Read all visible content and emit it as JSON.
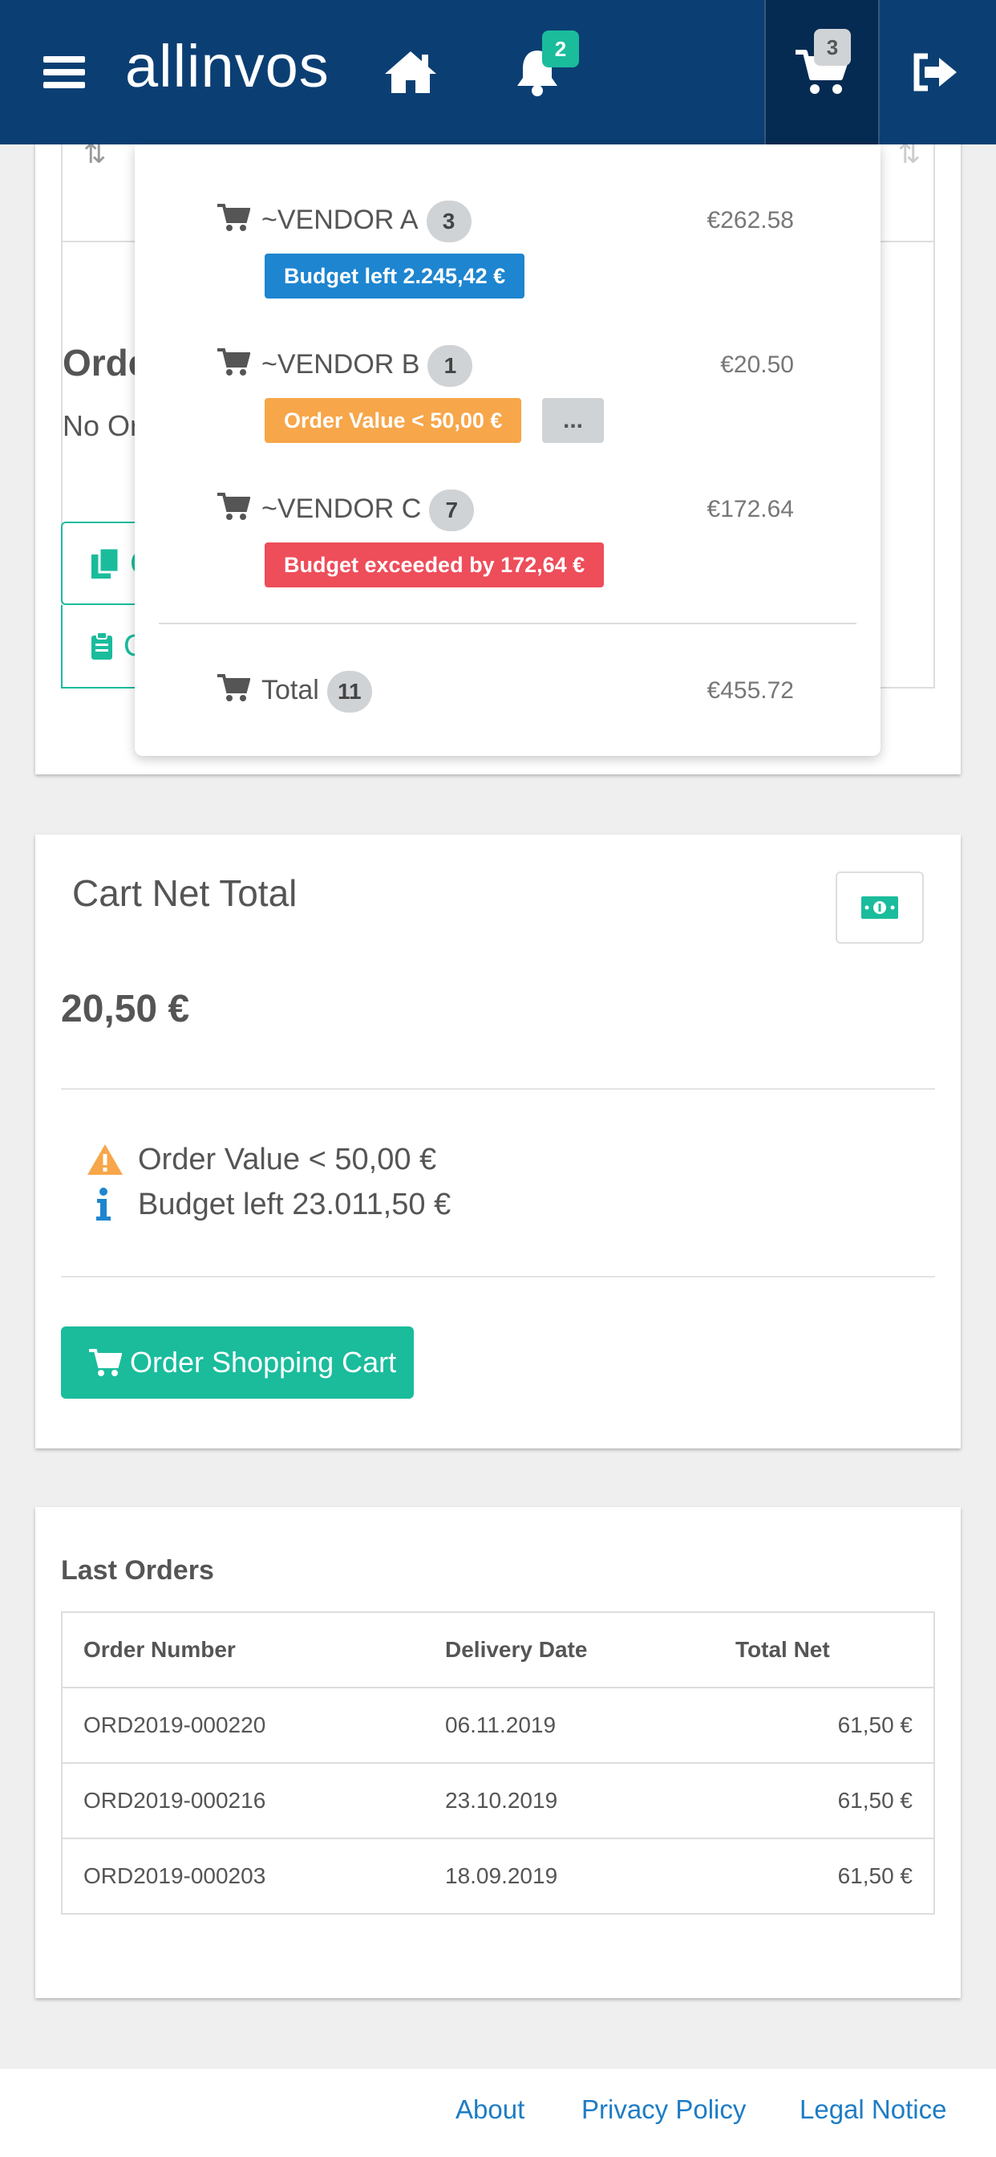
{
  "navbar": {
    "brand": "allinvos",
    "notifications_count": "2",
    "cart_count": "3"
  },
  "background_card": {
    "orders_title": "Orde",
    "no_orders": "No Or",
    "btn_copy": "C",
    "btn_clip": "C"
  },
  "cart_dropdown": {
    "vendors": [
      {
        "name": "~VENDOR A",
        "count": "3",
        "amount": "€262.58",
        "tag": "Budget left 2.245,42 €",
        "tag_color": "#1e85d0"
      },
      {
        "name": "~VENDOR B",
        "count": "1",
        "amount": "€20.50",
        "tag": "Order Value < 50,00 €",
        "tag_color": "#f7a64a",
        "more": "..."
      },
      {
        "name": "~VENDOR C",
        "count": "7",
        "amount": "€172.64",
        "tag": "Budget exceeded by 172,64 €",
        "tag_color": "#ee4d5a"
      }
    ],
    "total": {
      "label": "Total",
      "count": "11",
      "amount": "€455.72"
    }
  },
  "cart_net_total": {
    "title": "Cart Net Total",
    "amount": "20,50 €",
    "warning": "Order Value < 50,00 €",
    "info": "Budget left 23.011,50 €",
    "order_button": "Order Shopping Cart"
  },
  "last_orders": {
    "title": "Last Orders",
    "columns": [
      "Order Number",
      "Delivery Date",
      "Total Net"
    ],
    "rows": [
      [
        "ORD2019-000220",
        "06.11.2019",
        "61,50 €"
      ],
      [
        "ORD2019-000216",
        "23.10.2019",
        "61,50 €"
      ],
      [
        "ORD2019-000203",
        "18.09.2019",
        "61,50 €"
      ]
    ]
  },
  "footer": {
    "about": "About",
    "privacy": "Privacy Policy",
    "legal": "Legal Notice"
  },
  "colors": {
    "navbar": "#0b3f73",
    "accent": "#1abc9c",
    "link": "#1e7cc4"
  }
}
